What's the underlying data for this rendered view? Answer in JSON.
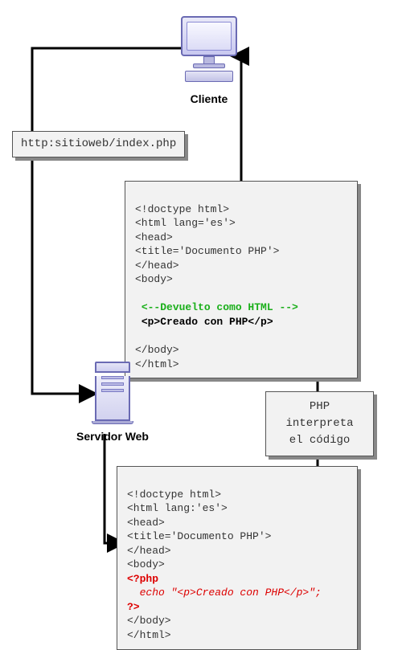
{
  "labels": {
    "client": "Cliente",
    "server": "Servidor Web"
  },
  "url_box": "http:sitioweb/index.php",
  "interpret_box": {
    "line1": "PHP interpreta",
    "line2": "el código"
  },
  "response_html": {
    "l1": "<!doctype html>",
    "l2": "<html lang='es'>",
    "l3": "<head>",
    "l4": "<title='Documento PHP'>",
    "l5": "</head>",
    "l6": "<body>",
    "comment": "<--Devuelto como HTML -->",
    "content": "<p>Creado con PHP</p>",
    "l7": "</body>",
    "l8": "</html>"
  },
  "source_html": {
    "l1": "<!doctype html>",
    "l2": "<html lang:'es'>",
    "l3": "<head>",
    "l4": "<title='Documento PHP'>",
    "l5": "</head>",
    "l6": "<body>",
    "php_open": "<?php",
    "echo": "  echo \"<p>Creado con PHP</p>\";",
    "php_close": "?>",
    "l7": "</body>",
    "l8": "</html>"
  }
}
